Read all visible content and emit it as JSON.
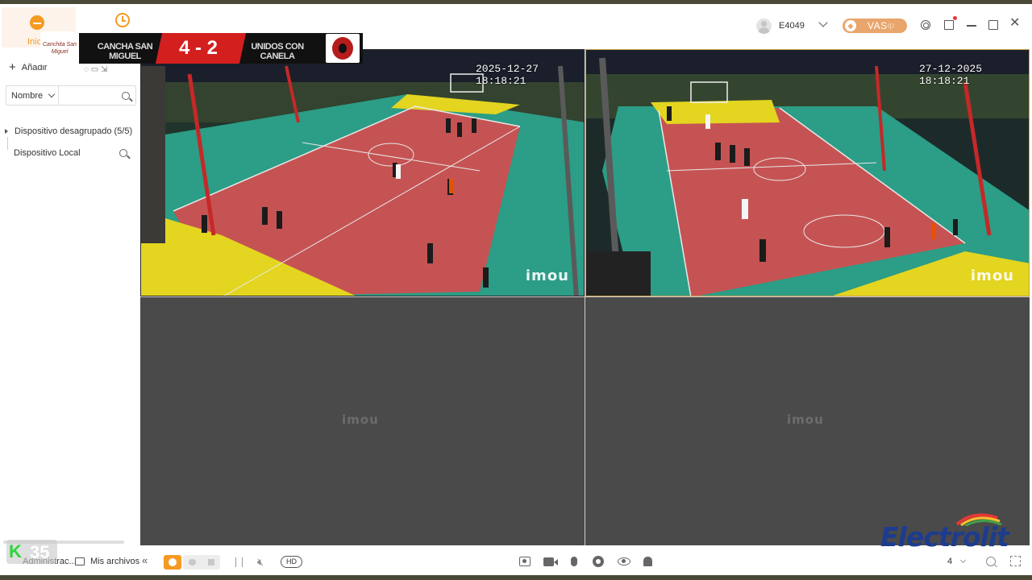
{
  "nav": {
    "home_label": "Inicio"
  },
  "user": {
    "name": "E4049"
  },
  "vas": {
    "label": "VAS",
    "suffix": "ip"
  },
  "sidebar": {
    "add_label": "Añadir",
    "search": {
      "filter_value": "Nombre",
      "placeholder": ""
    },
    "tree": [
      {
        "label": "Dispositivo desagrupado (5/5)"
      },
      {
        "label": "Dispositivo Local"
      }
    ]
  },
  "scoreboard": {
    "team1": "CANCHA SAN MIGUEL",
    "score": "4 - 2",
    "team2": "UNIDOS CON CANELA",
    "logo1_text": "Canchita San Miguel"
  },
  "cameras": [
    {
      "timestamp": "2025-12-27 18:18:21",
      "watermark": "imou"
    },
    {
      "timestamp": "27-12-2025 18:18:21",
      "watermark": "imou"
    },
    {
      "timestamp": "",
      "watermark": "imou"
    },
    {
      "timestamp": "",
      "watermark": "imou"
    }
  ],
  "bottom": {
    "admin_label": "Administrac...",
    "files_label": "Mis archivos",
    "hd_label": "HD",
    "layout_value": "4"
  },
  "overlay": {
    "badge_k": "K",
    "badge_number": "35",
    "sponsor": "Electrolit"
  },
  "colors": {
    "accent": "#f59a23",
    "vas": "#e8a56c",
    "grid_bg": "#4a4a4a",
    "court_red": "#c65353",
    "court_green": "#2fa586",
    "court_yellow": "#e3d520"
  }
}
